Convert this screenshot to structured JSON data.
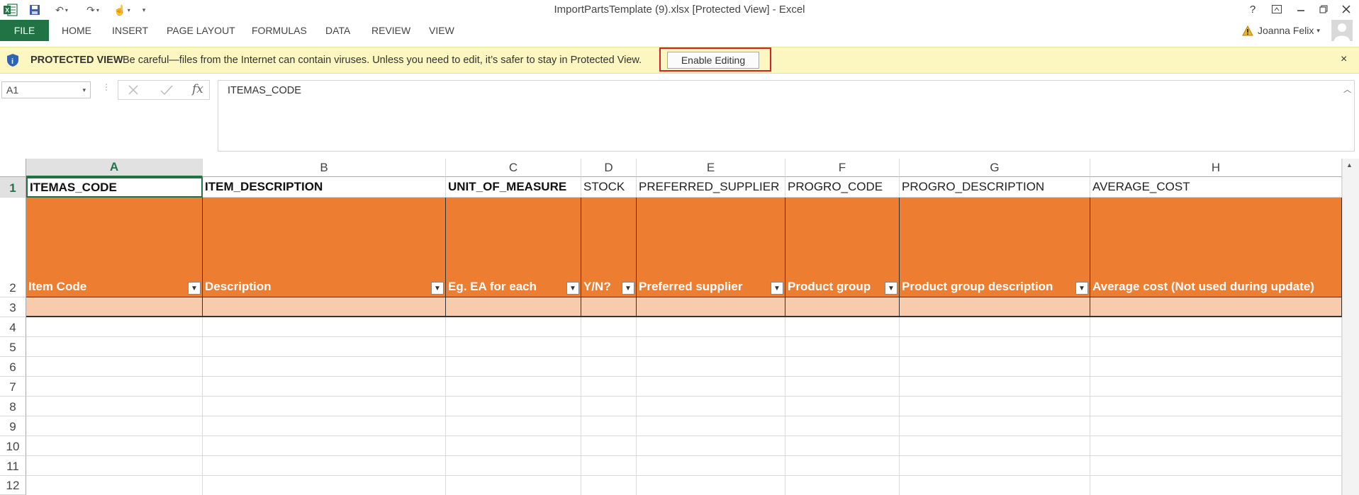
{
  "window": {
    "title": "ImportPartsTemplate (9).xlsx  [Protected View] - Excel",
    "user_name": "Joanna Felix",
    "help_label": "?"
  },
  "ribbon": {
    "file_label": "FILE",
    "tabs": [
      "HOME",
      "INSERT",
      "PAGE LAYOUT",
      "FORMULAS",
      "DATA",
      "REVIEW",
      "VIEW"
    ]
  },
  "protected_view": {
    "heading": "PROTECTED VIEW",
    "message": "Be careful—files from the Internet can contain viruses. Unless you need to edit, it’s safer to stay in Protected View.",
    "button_label": "Enable Editing",
    "close_label": "×"
  },
  "formula_bar": {
    "name_box": "A1",
    "fx_label": "fx",
    "content": "ITEMAS_CODE"
  },
  "sheet": {
    "columns": [
      "A",
      "B",
      "C",
      "D",
      "E",
      "F",
      "G",
      "H"
    ],
    "selected_column": "A",
    "rows": [
      "1",
      "2",
      "3",
      "4",
      "5",
      "6",
      "7",
      "8",
      "9",
      "10",
      "11",
      "12"
    ],
    "header_row": [
      "ITEMAS_CODE",
      "ITEM_DESCRIPTION",
      "UNIT_OF_MEASURE",
      "STOCK",
      "PREFERRED_SUPPLIER",
      "PROGRO_CODE",
      "PROGRO_DESCRIPTION",
      "AVERAGE_COST"
    ],
    "label_row": [
      "Item Code",
      "Description",
      "Eg. EA for each",
      "Y/N?",
      "Preferred supplier",
      "Product group",
      "Product group description",
      "Average cost (Not used during update)"
    ],
    "colors": {
      "accent": "#217346",
      "label_fill": "#ed7d31",
      "row3_fill": "#f8cbad",
      "protected_bar": "#fcf6c0",
      "highlight_border": "#d9202a"
    }
  }
}
